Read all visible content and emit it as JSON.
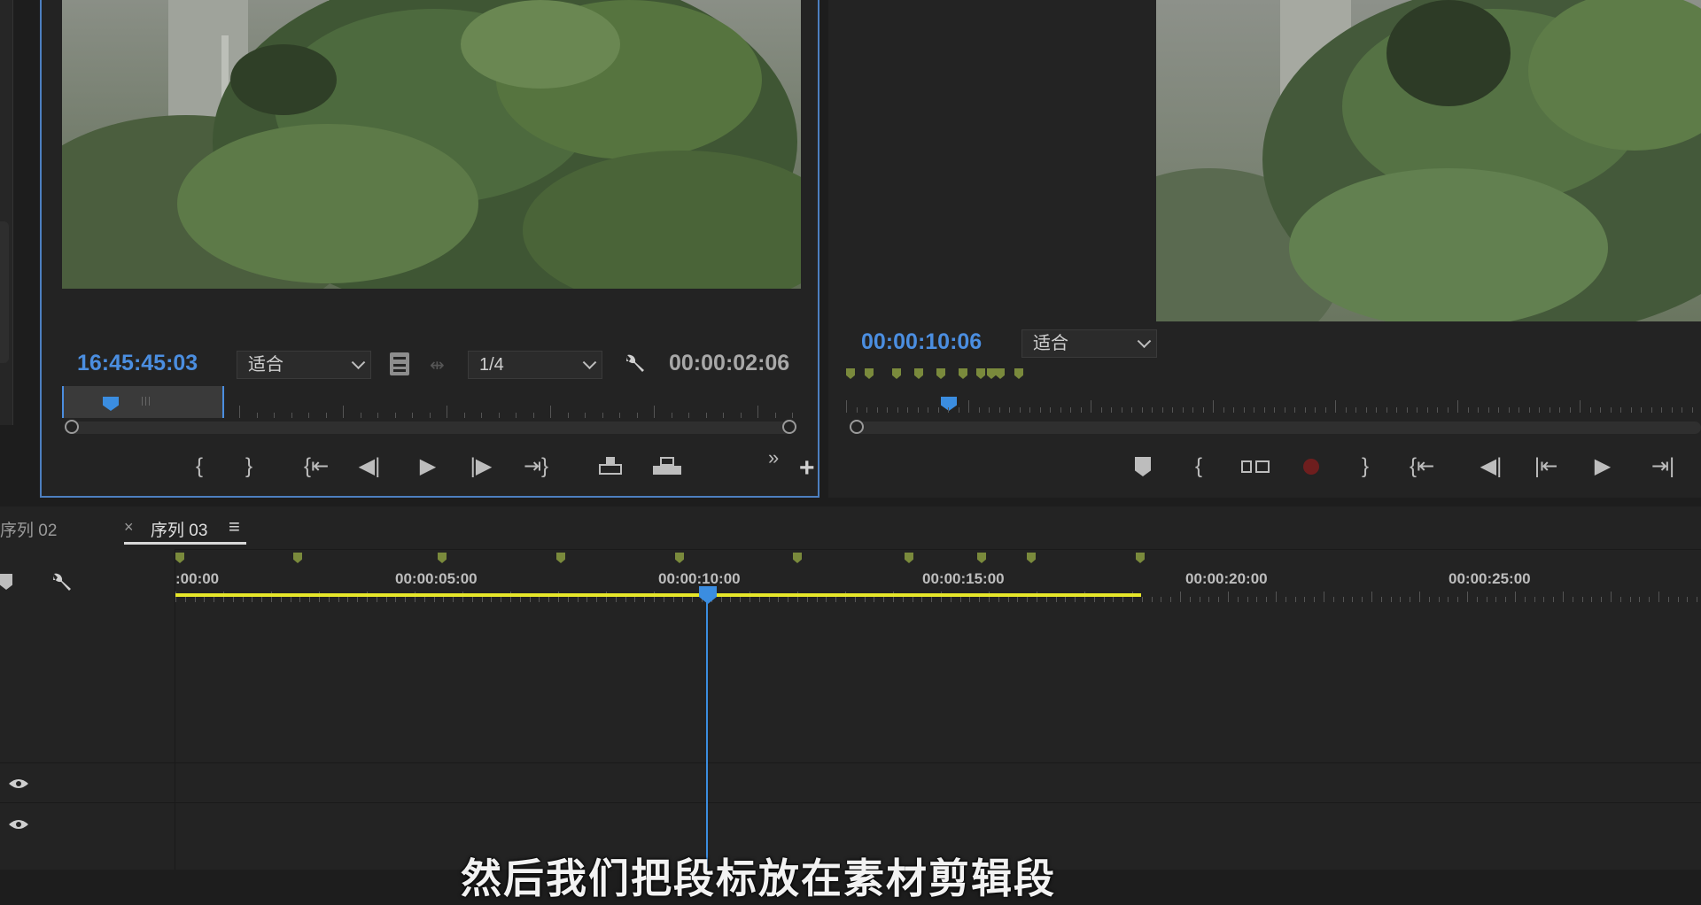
{
  "source_monitor": {
    "timecode_current": "16:45:45:03",
    "zoom_select": "适合",
    "resolution_select": "1/4",
    "timecode_duration": "00:00:02:06",
    "controls": [
      "mark-in",
      "mark-out",
      "go-to-in",
      "step-back",
      "play",
      "step-forward",
      "go-to-out",
      "insert",
      "overwrite",
      "more",
      "add"
    ]
  },
  "program_monitor": {
    "timecode_current": "00:00:10:06",
    "zoom_select": "适合",
    "controls": [
      "add-marker",
      "mark-in",
      "trim",
      "record",
      "mark-out",
      "go-to-in",
      "step-back",
      "go-to-prev",
      "play",
      "go-to-out"
    ]
  },
  "timeline": {
    "tabs": [
      {
        "label": "序列 02",
        "active": false
      },
      {
        "label": "序列 03",
        "active": true
      }
    ],
    "close_glyph": "×",
    "menu_glyph": "≡",
    "ruler_labels": [
      ":00:00",
      "00:00:05:00",
      "00:00:10:00",
      "00:00:15:00",
      "00:00:20:00",
      "00:00:25:00"
    ],
    "playhead_time": "00:00:10:00"
  },
  "subtitle": "然后我们把段标放在素材剪辑段",
  "colors": {
    "accent_blue": "#4b8ee0",
    "marker_green": "#7a8a3c",
    "work_area_yellow": "#e6e62a",
    "panel_bg": "#232323"
  }
}
